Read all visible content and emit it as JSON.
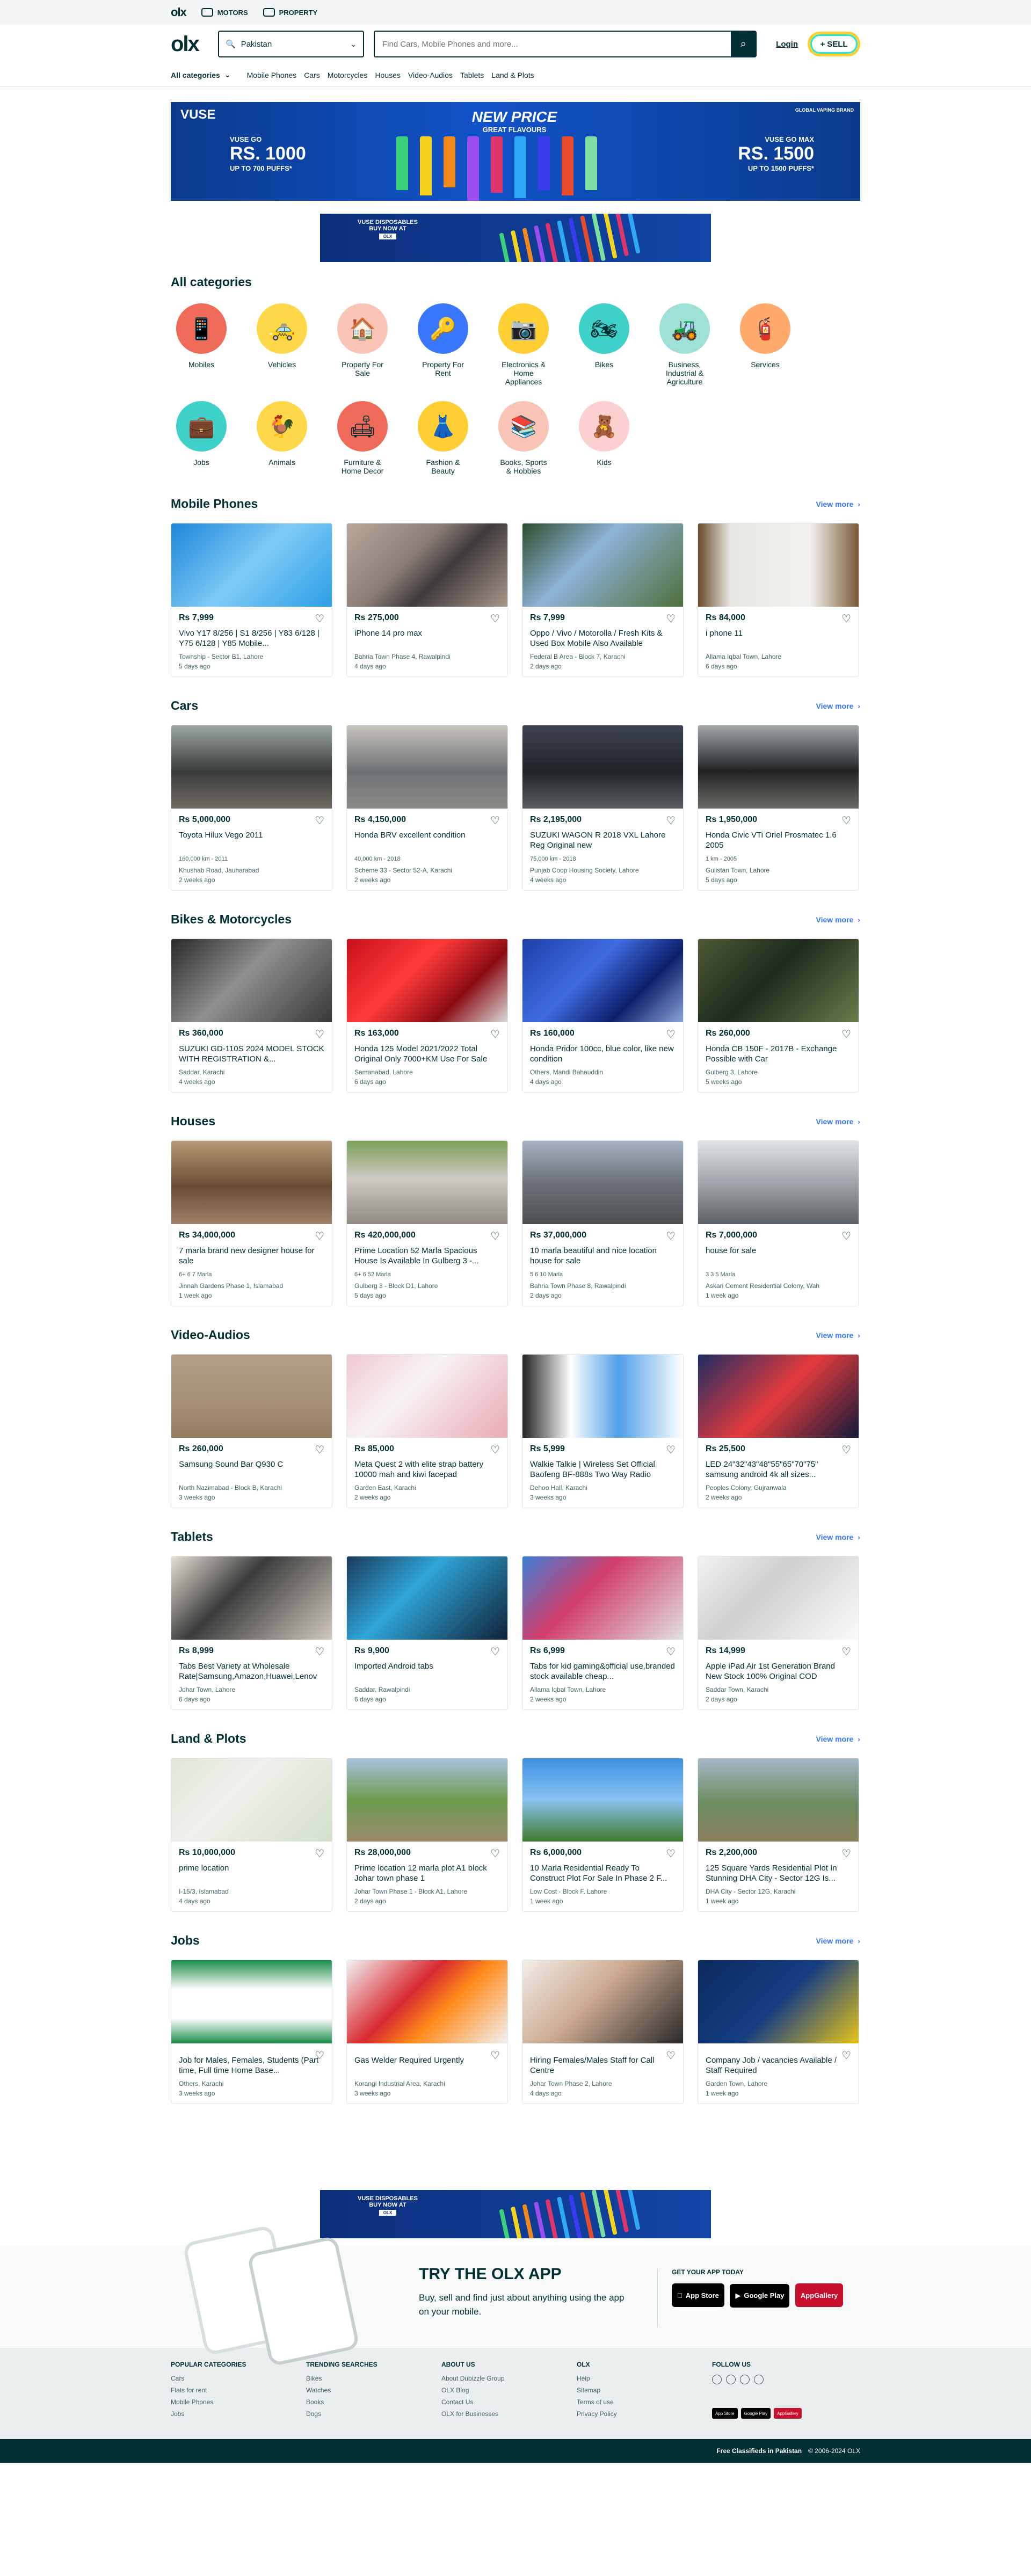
{
  "topbar": {
    "motors": "MOTORS",
    "property": "PROPERTY"
  },
  "header": {
    "logo": "olx",
    "location": "Pakistan",
    "search_placeholder": "Find Cars, Mobile Phones and more...",
    "login": "Login",
    "sell": "SELL"
  },
  "subnav": {
    "all_categories": "All categories",
    "links": [
      "Mobile Phones",
      "Cars",
      "Motorcycles",
      "Houses",
      "Video-Audios",
      "Tablets",
      "Land & Plots"
    ]
  },
  "banner": {
    "brand": "VUSE",
    "headline": "NEW PRICE",
    "subline": "GREAT FLAVOURS",
    "left_name": "VUSE GO",
    "left_price": "RS. 1000",
    "left_puffs": "UP TO 700 PUFFS*",
    "right_name": "VUSE GO MAX",
    "right_price": "RS. 1500",
    "right_puffs": "UP TO 1500 PUFFS*",
    "badge": "GLOBAL VAPING BRAND",
    "small_title": "VUSE DISPOSABLES",
    "small_buy": "BUY NOW AT"
  },
  "categories_title": "All categories",
  "categories": [
    {
      "name": "Mobiles",
      "icon": "📱",
      "bg": "#f06a5a"
    },
    {
      "name": "Vehicles",
      "icon": "🚕",
      "bg": "#ffd84a"
    },
    {
      "name": "Property For Sale",
      "icon": "🏠",
      "bg": "#f9c4b6"
    },
    {
      "name": "Property For Rent",
      "icon": "🔑",
      "bg": "#3a77ff"
    },
    {
      "name": "Electronics & Home Appliances",
      "icon": "📷",
      "bg": "#ffce32"
    },
    {
      "name": "Bikes",
      "icon": "🏍",
      "bg": "#3ed1c9"
    },
    {
      "name": "Business, Industrial & Agriculture",
      "icon": "🚜",
      "bg": "#9ee0d6"
    },
    {
      "name": "Services",
      "icon": "🧯",
      "bg": "#ffa96b"
    },
    {
      "name": "Jobs",
      "icon": "💼",
      "bg": "#3ed1c9"
    },
    {
      "name": "Animals",
      "icon": "🐓",
      "bg": "#ffd84a"
    },
    {
      "name": "Furniture & Home Decor",
      "icon": "🛋",
      "bg": "#f06a5a"
    },
    {
      "name": "Fashion & Beauty",
      "icon": "👗",
      "bg": "#ffce32"
    },
    {
      "name": "Books, Sports & Hobbies",
      "icon": "📚",
      "bg": "#f9c4b6"
    },
    {
      "name": "Kids",
      "icon": "🧸",
      "bg": "#fdd0d0"
    }
  ],
  "view_more": "View more",
  "sections": [
    {
      "title": "Mobile Phones",
      "items": [
        {
          "price": "Rs 7,999",
          "title": "Vivo Y17 8/256 | S1 8/256 | Y83 6/128 | Y75 6/128 | Y85 Mobile...",
          "meta": "",
          "loc": "Township - Sector B1, Lahore",
          "date": "5 days ago",
          "img": "linear-gradient(135deg,#1b86d8,#7fcaf5,#2a9ee6)"
        },
        {
          "price": "Rs 275,000",
          "title": "iPhone 14 pro max",
          "meta": "",
          "loc": "Bahria Town Phase 4, Rawalpindi",
          "date": "4 days ago",
          "img": "linear-gradient(135deg,#b9a89a,#8a7d75 40%,#3f3b3d 60%,#a89787)"
        },
        {
          "price": "Rs 7,999",
          "title": "Oppo / Vivo / Motorolla / Fresh Kits & Used Box Mobile Also Available",
          "meta": "",
          "loc": "Federal B Area - Block 7, Karachi",
          "date": "2 days ago",
          "img": "linear-gradient(135deg,#2d4e2b,#8db3d7 40%,#4e6f3a)"
        },
        {
          "price": "Rs 84,000",
          "title": "i phone 11",
          "meta": "",
          "loc": "Allama Iqbal Town, Lahore",
          "date": "6 days ago",
          "img": "linear-gradient(90deg,#6a4a2a,#e8e6e2 20%,#f2f1ee 70%,#7a5a34)"
        }
      ]
    },
    {
      "title": "Cars",
      "items": [
        {
          "price": "Rs 5,000,000",
          "title": "Toyota Hilux Vego 2011",
          "meta": "160,000 km - 2011",
          "loc": "Khushab Road, Jauharabad",
          "date": "2 weeks ago",
          "img": "linear-gradient(180deg,#9ba6a3,#3a3d3c 55%,#6e6a60)"
        },
        {
          "price": "Rs 4,150,000",
          "title": "Honda BRV excellent condition",
          "meta": "40,000 km - 2018",
          "loc": "Scheme 33 - Sector 52-A, Karachi",
          "date": "2 weeks ago",
          "img": "linear-gradient(180deg,#c8c4bd,#6f7275 55%,#8b8a86)"
        },
        {
          "price": "Rs 2,195,000",
          "title": "SUZUKI WAGON R 2018 VXL Lahore Reg Original new",
          "meta": "75,000 km - 2018",
          "loc": "Punjab Coop Housing Society, Lahore",
          "date": "4 weeks ago",
          "img": "linear-gradient(180deg,#3d4350,#1f2328 55%,#5a5e63)"
        },
        {
          "price": "Rs 1,950,000",
          "title": "Honda Civic VTi Oriel Prosmatec 1.6 2005",
          "meta": "1 km - 2005",
          "loc": "Gulistan Town, Lahore",
          "date": "5 days ago",
          "img": "linear-gradient(180deg,#a3a7a9,#202224 55%,#6c6a65)"
        }
      ]
    },
    {
      "title": "Bikes & Motorcycles",
      "items": [
        {
          "price": "Rs 360,000",
          "title": "SUZUKI GD-110S 2024 MODEL STOCK WITH REGISTRATION &...",
          "meta": "",
          "loc": "Saddar, Karachi",
          "date": "4 weeks ago",
          "img": "linear-gradient(135deg,#2a2a2a,#8f8f8f 45%,#383838)"
        },
        {
          "price": "Rs 163,000",
          "title": "Honda 125 Model 2021/2022 Total Original Only 7000+KM Use For Sale",
          "meta": "",
          "loc": "Samanabad, Lahore",
          "date": "6 days ago",
          "img": "linear-gradient(135deg,#c7101a,#ff3a3a 40%,#8c0c12 70%,#d9d9d9)"
        },
        {
          "price": "Rs 160,000",
          "title": "Honda Pridor 100cc, blue color, like new condition",
          "meta": "",
          "loc": "Others, Mandi Bahauddin",
          "date": "4 days ago",
          "img": "linear-gradient(135deg,#1d3fa8,#3f6be0 40%,#0c1f6a 70%,#8aa4d6)"
        },
        {
          "price": "Rs 260,000",
          "title": "Honda CB 150F - 2017B - Exchange Possible with Car",
          "meta": "",
          "loc": "Gulberg 3, Lahore",
          "date": "5 weeks ago",
          "img": "linear-gradient(135deg,#4c5a34,#1d2a1c 45%,#6b7b4a)"
        }
      ]
    },
    {
      "title": "Houses",
      "items": [
        {
          "price": "Rs 34,000,000",
          "title": "7 marla brand new designer house for sale",
          "meta": "6+   6   7 Marla",
          "loc": "Jinnah Gardens Phase 1, Islamabad",
          "date": "1 week ago",
          "img": "linear-gradient(180deg,#b79a76,#6b4c33 55%,#a08168)"
        },
        {
          "price": "Rs 420,000,000",
          "title": "Prime Location 52 Marla Spacious House Is Available In Gulberg 3 -...",
          "meta": "6+   6   52 Marla",
          "loc": "Gulberg 3 - Block D1, Lahore",
          "date": "5 days ago",
          "img": "linear-gradient(180deg,#7aa05a,#cfcac2 45%,#8f8a82)"
        },
        {
          "price": "Rs 37,000,000",
          "title": "10 marla beautiful and nice location house for sale",
          "meta": "5   6   10 Marla",
          "loc": "Bahria Town Phase 8, Rawalpindi",
          "date": "2 days ago",
          "img": "linear-gradient(180deg,#a6b3c3,#6c7178 50%,#4d4f52)"
        },
        {
          "price": "Rs 7,000,000",
          "title": "house for sale",
          "meta": "3   3   5 Marla",
          "loc": "Askari Cement Residential Colony, Wah",
          "date": "1 week ago",
          "img": "linear-gradient(180deg,#e0e3e6,#9fa5aa 50%,#5d6266)"
        }
      ]
    },
    {
      "title": "Video-Audios",
      "items": [
        {
          "price": "Rs 260,000",
          "title": "Samsung Sound Bar Q930 C",
          "meta": "",
          "loc": "North Nazimabad - Block B, Karachi",
          "date": "3 weeks ago",
          "img": "linear-gradient(180deg,#b29e86,#a68f74 60%,#927b60)"
        },
        {
          "price": "Rs 85,000",
          "title": "Meta Quest 2 with elite strap battery 10000 mah and kiwi facepad",
          "meta": "",
          "loc": "Garden East, Karachi",
          "date": "2 weeks ago",
          "img": "linear-gradient(135deg,#f0c9d0,#f7f2f3 40%,#e9aab5)"
        },
        {
          "price": "Rs 5,999",
          "title": "Walkie Talkie | Wireless Set Official Baofeng BF-888s Two Way Radio",
          "meta": "",
          "loc": "Dehoo Hall, Karachi",
          "date": "3 weeks ago",
          "img": "linear-gradient(90deg,#222,#fff 30%,#4fa0e8 60%,#fff)"
        },
        {
          "price": "Rs 25,500",
          "title": "LED 24\"32\"43\"48\"55\"65\"70\"75\" samsung android 4k all sizes...",
          "meta": "",
          "loc": "Peoples Colony, Gujranwala",
          "date": "2 weeks ago",
          "img": "linear-gradient(135deg,#1d2b63,#e43b3b 50%,#131a3a)"
        }
      ]
    },
    {
      "title": "Tablets",
      "items": [
        {
          "price": "Rs 8,999",
          "title": "Tabs Best Variety at Wholesale Rate|Samsung,Amazon,Huawei,Lenov",
          "meta": "",
          "loc": "Johar Town, Lahore",
          "date": "6 days ago",
          "img": "linear-gradient(135deg,#e6e0d6,#3c3c3c 40%,#cfc8bd)"
        },
        {
          "price": "Rs 9,900",
          "title": "Imported Android tabs",
          "meta": "",
          "loc": "Saddar, Rawalpindi",
          "date": "6 days ago",
          "img": "linear-gradient(135deg,#1b3a5a,#2fa5d8 40%,#0f2238)"
        },
        {
          "price": "Rs 6,999",
          "title": "Tabs for kid gaming&official use,branded stock available cheap...",
          "meta": "",
          "loc": "Allama Iqbal Town, Lahore",
          "date": "2 weeks ago",
          "img": "linear-gradient(135deg,#3a7bd5,#d23e6b 40%,#e0e0e0)"
        },
        {
          "price": "Rs 14,999",
          "title": "Apple iPad Air 1st Generation Brand New Stock 100% Original COD",
          "meta": "",
          "loc": "Saddar Town, Karachi",
          "date": "2 days ago",
          "img": "linear-gradient(135deg,#f2f2f2,#cfcfcf 40%,#fafafa)"
        }
      ]
    },
    {
      "title": "Land & Plots",
      "items": [
        {
          "price": "Rs 10,000,000",
          "title": "prime location",
          "meta": "",
          "loc": "I-15/3, Islamabad",
          "date": "4 days ago",
          "img": "linear-gradient(135deg,#dfe6d8,#eef0ea 40%,#d3e0cb)"
        },
        {
          "price": "Rs 28,000,000",
          "title": "Prime location 12 marla plot A1 block Johar town phase 1",
          "meta": "",
          "loc": "Johar Town Phase 1 - Block A1, Lahore",
          "date": "2 days ago",
          "img": "linear-gradient(180deg,#a8c2dc,#6c9b4e 50%,#9b8a6a)"
        },
        {
          "price": "Rs 6,000,000",
          "title": "10 Marla Residential Ready To Construct Plot For Sale In Phase 2 F...",
          "meta": "",
          "loc": "Low Cost - Block F, Lahore",
          "date": "1 week ago",
          "img": "linear-gradient(180deg,#3d8fe0,#89c3f2 50%,#3f7a2e)"
        },
        {
          "price": "Rs 2,200,000",
          "title": "125 Square Yards Residential Plot In Stunning DHA City - Sector 12G Is...",
          "meta": "",
          "loc": "DHA City - Sector 12G, Karachi",
          "date": "1 week ago",
          "img": "linear-gradient(180deg,#a4b6c6,#6a8c5e 55%,#8a7f5e)"
        }
      ]
    },
    {
      "title": "Jobs",
      "items": [
        {
          "price": "",
          "title": "Job for Males, Females, Students (Part time, Full time Home Base...",
          "meta": "",
          "loc": "Others, Karachi",
          "date": "3 weeks ago",
          "img": "linear-gradient(180deg,#1c8c4a,#ffffff 35%,#fff 70%,#1c8c4a)"
        },
        {
          "price": "",
          "title": "Gas Welder Required Urgently",
          "meta": "",
          "loc": "Korangi Industrial Area, Karachi",
          "date": "3 weeks ago",
          "img": "linear-gradient(135deg,#f2f2f2,#d8292f 40%,#ff8a1a 60%,#f2f2f2)"
        },
        {
          "price": "",
          "title": "Hiring Females/Males Staff for Call Centre",
          "meta": "",
          "loc": "Johar Town Phase 2, Lahore",
          "date": "4 days ago",
          "img": "linear-gradient(135deg,#f3eee8,#caa88e 45%,#2b2b2b)"
        },
        {
          "price": "",
          "title": "Company Job / vacancies Available / Staff Required",
          "meta": "",
          "loc": "Garden Town, Lahore",
          "date": "1 week ago",
          "img": "linear-gradient(135deg,#0b2a5c,#143d82 50%,#e8c41a)"
        }
      ]
    }
  ],
  "app": {
    "title": "TRY THE OLX APP",
    "desc": "Buy, sell and find just about anything using the app on your mobile.",
    "get_app": "GET YOUR APP TODAY",
    "stores": [
      "App Store",
      "Google Play",
      "AppGallery"
    ]
  },
  "footer": {
    "cols": [
      {
        "title": "POPULAR CATEGORIES",
        "links": [
          "Cars",
          "Flats for rent",
          "Mobile Phones",
          "Jobs"
        ]
      },
      {
        "title": "TRENDING SEARCHES",
        "links": [
          "Bikes",
          "Watches",
          "Books",
          "Dogs"
        ]
      },
      {
        "title": "ABOUT US",
        "links": [
          "About Dubizzle Group",
          "OLX Blog",
          "Contact Us",
          "OLX for Businesses"
        ]
      },
      {
        "title": "OLX",
        "links": [
          "Help",
          "Sitemap",
          "Terms of use",
          "Privacy Policy"
        ]
      }
    ],
    "follow": "FOLLOW US"
  },
  "bottom": {
    "left": "Free Classifieds in Pakistan",
    "right": "© 2006-2024 OLX"
  }
}
